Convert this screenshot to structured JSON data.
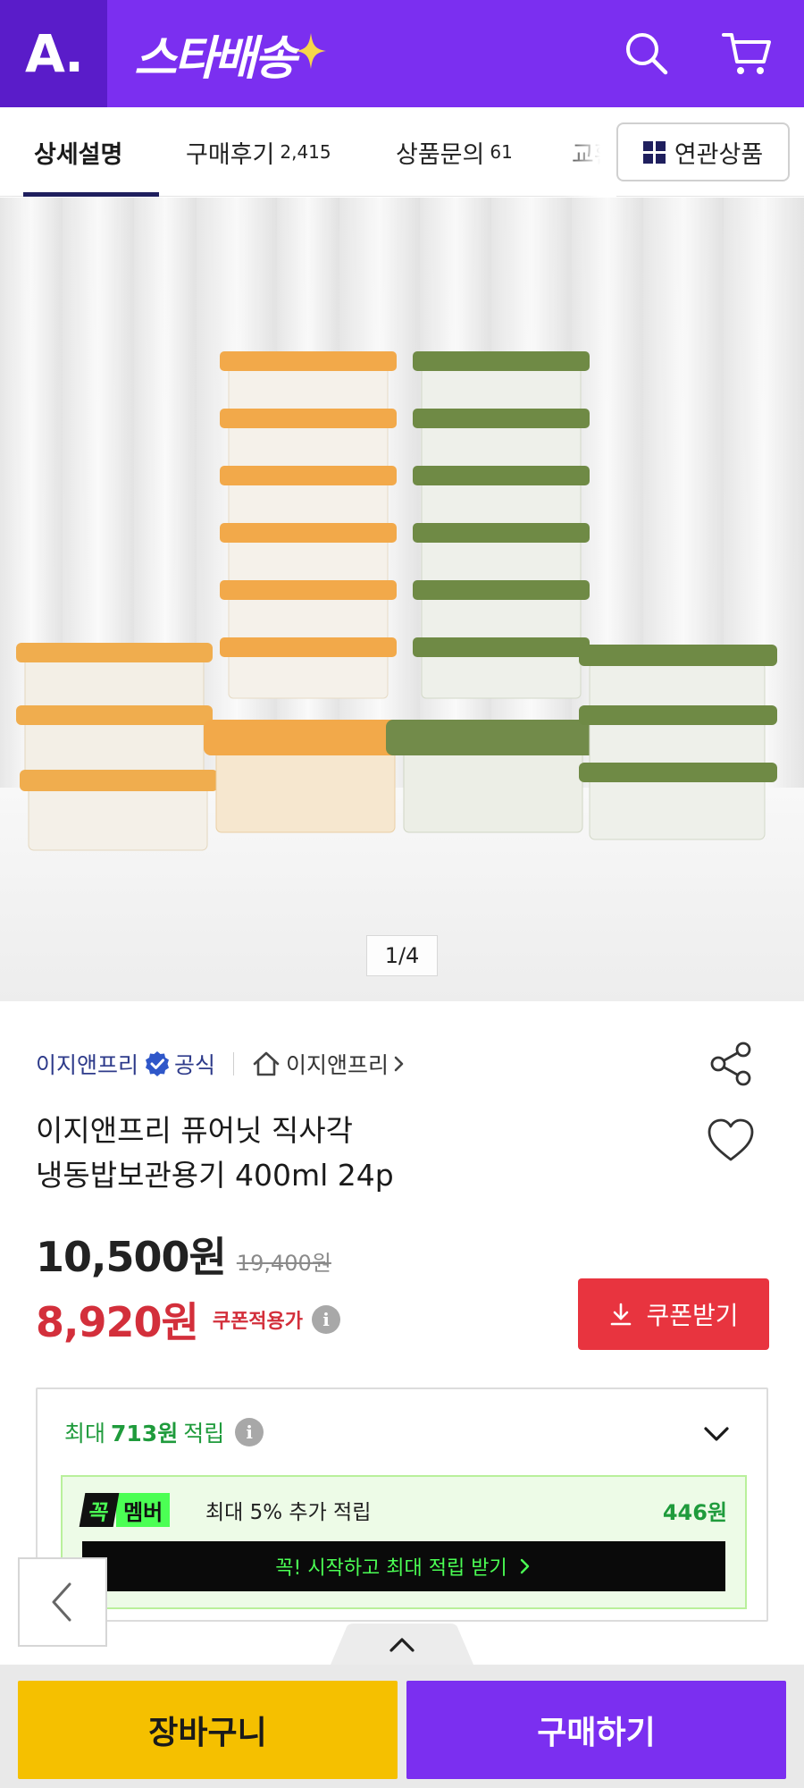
{
  "header": {
    "logo_text": "A.",
    "service_name": "스타배송",
    "icons": [
      "search-icon",
      "cart-icon"
    ],
    "colors": {
      "primary": "#7b2ff0",
      "logo_bg": "#5a1cc9",
      "sparkle": "#f7d64a"
    }
  },
  "tabs": [
    {
      "label": "상세설명",
      "count": "",
      "active": true
    },
    {
      "label": "구매후기",
      "count": "2,415",
      "active": false
    },
    {
      "label": "상품문의",
      "count": "61",
      "active": false
    },
    {
      "label": "교환",
      "count": "",
      "active": false
    }
  ],
  "related_button": {
    "label": "연관상품",
    "icon": "grid-icon"
  },
  "gallery": {
    "indicator": "1/4",
    "current": 1,
    "total": 4
  },
  "seller": {
    "name": "이지앤프리",
    "badge": "공식",
    "store_link": "이지앤프리",
    "icons": [
      "verified-icon",
      "home-icon",
      "chevron-right-icon",
      "share-icon",
      "heart-icon"
    ]
  },
  "product": {
    "title_line1": "이지앤프리 퓨어닛 직사각",
    "title_line2": "냉동밥보관용기 400ml 24p"
  },
  "price": {
    "sale": "10,500원",
    "original": "19,400원",
    "coupon_price": "8,920원",
    "coupon_label": "쿠폰적용가",
    "coupon_button": "쿠폰받기",
    "colors": {
      "coupon": "#d32f3b"
    }
  },
  "reward": {
    "prefix": "최대",
    "amount": "713원",
    "suffix": "적립",
    "member": {
      "badge_part1": "꼭",
      "badge_part2": "멤버",
      "text": "최대 5% 추가 적립",
      "amount": "446원",
      "cta": "꼭! 시작하고 최대 적립 받기"
    },
    "colors": {
      "green": "#1f9b3c",
      "member_neon": "#4bff54"
    }
  },
  "bottom": {
    "cart": "장바구니",
    "buy": "구매하기",
    "colors": {
      "cart": "#f5c000",
      "buy": "#7b2ff0"
    }
  }
}
